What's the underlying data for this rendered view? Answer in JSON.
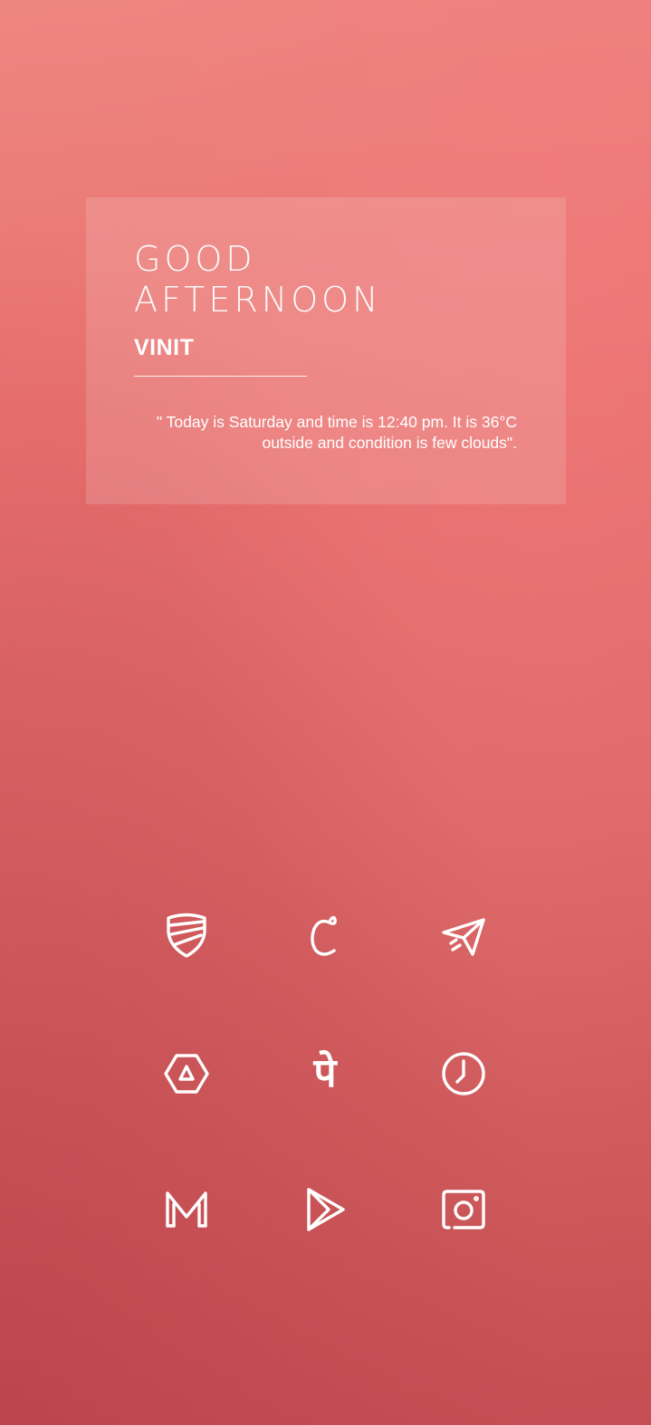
{
  "greeting": {
    "line1": "GOOD",
    "line2": "AFTERNOON",
    "name": "VINIT",
    "status_line": "\" Today is Saturday and time is 12:40 pm. It is 36°C outside and condition is few clouds\"."
  },
  "apps": [
    {
      "name": "shield-app",
      "icon": "shield-stripes-icon"
    },
    {
      "name": "c-app",
      "icon": "letter-c-icon"
    },
    {
      "name": "send-app",
      "icon": "paper-plane-icon"
    },
    {
      "name": "drive-app",
      "icon": "hexagon-triangle-icon"
    },
    {
      "name": "phonepe-app",
      "icon": "devanagari-pe-icon",
      "glyph": "पे"
    },
    {
      "name": "clock-app",
      "icon": "clock-icon"
    },
    {
      "name": "gmail-app",
      "icon": "letter-m-icon"
    },
    {
      "name": "play-store-app",
      "icon": "play-triangle-icon"
    },
    {
      "name": "instagram-app",
      "icon": "camera-icon"
    }
  ],
  "colors": {
    "background_top": "#ee8680",
    "background_bottom": "#c34e53",
    "card_overlay": "rgba(255,255,255,0.14)",
    "foreground": "#ffffff"
  }
}
